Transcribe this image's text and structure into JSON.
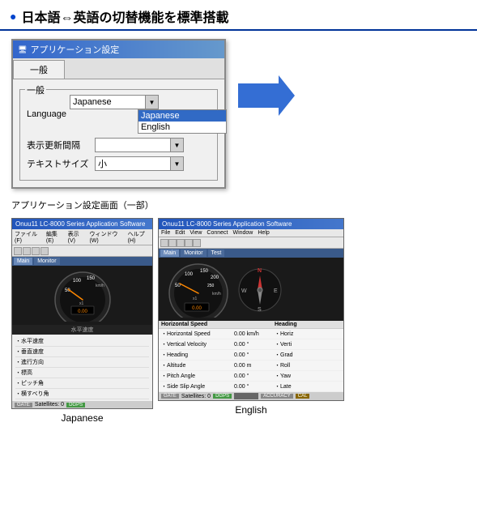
{
  "header": {
    "title": "日本語⇔英語の切替機能を標準搭載",
    "icon": "●"
  },
  "dialog": {
    "title": "アプリケーション設定",
    "tab": "一般",
    "group_label": "一般",
    "fields": [
      {
        "label": "Language",
        "value": "Japanese",
        "options": [
          "Japanese",
          "English"
        ]
      },
      {
        "label": "表示更新間隔",
        "value": ""
      },
      {
        "label": "テキストサイズ",
        "value": "小"
      }
    ],
    "caption": "アプリケーション設定画面（一部）"
  },
  "japanese_app": {
    "title": "Onuu11 LC-8000 Series Application Software",
    "menubar": [
      "ファイル(F)",
      "編集(E)",
      "表示(V)",
      "ウィンドウ(W)",
      "ヘルプ(H)"
    ],
    "tabs": [
      "Main",
      "Monitor"
    ],
    "gauge_label": "水平速度",
    "data_items": [
      "・水平速度",
      "・垂直速度",
      "・進行方向",
      "・標高",
      "・ピッチ角",
      "・横すべり角"
    ],
    "status_items": [
      "GATE",
      "Satellites: 0",
      "DGPS"
    ],
    "label": "Japanese"
  },
  "english_app": {
    "title": "Onuu11 LC-8000 Series Application Software",
    "menubar": [
      "File",
      "Edit",
      "View",
      "Connect",
      "Window",
      "Help"
    ],
    "tabs": [
      "Main",
      "Monitor",
      "Test"
    ],
    "gauge_label": "Horizontal Speed",
    "heading_label": "Heading",
    "data_items": [
      {
        "name": "・Horizontal Speed",
        "value": "0.00 km/h"
      },
      {
        "name": "・Vertical Velocity",
        "value": "0.00 °"
      },
      {
        "name": "・Heading",
        "value": "0.00 °"
      },
      {
        "name": "・Altitude",
        "value": "0.00 m"
      },
      {
        "name": "・Pitch Angle",
        "value": "0.00 °"
      },
      {
        "name": "・Side Slip Angle",
        "value": "0.00 °"
      }
    ],
    "right_items": [
      "・Horiz",
      "・Verti",
      "・Grad",
      "・Roll",
      "・Yaw",
      "・Late"
    ],
    "status_items": [
      "GATE",
      "Satellites: 0",
      "DGPS",
      "ACCURACY",
      "CAL"
    ],
    "label": "English"
  }
}
